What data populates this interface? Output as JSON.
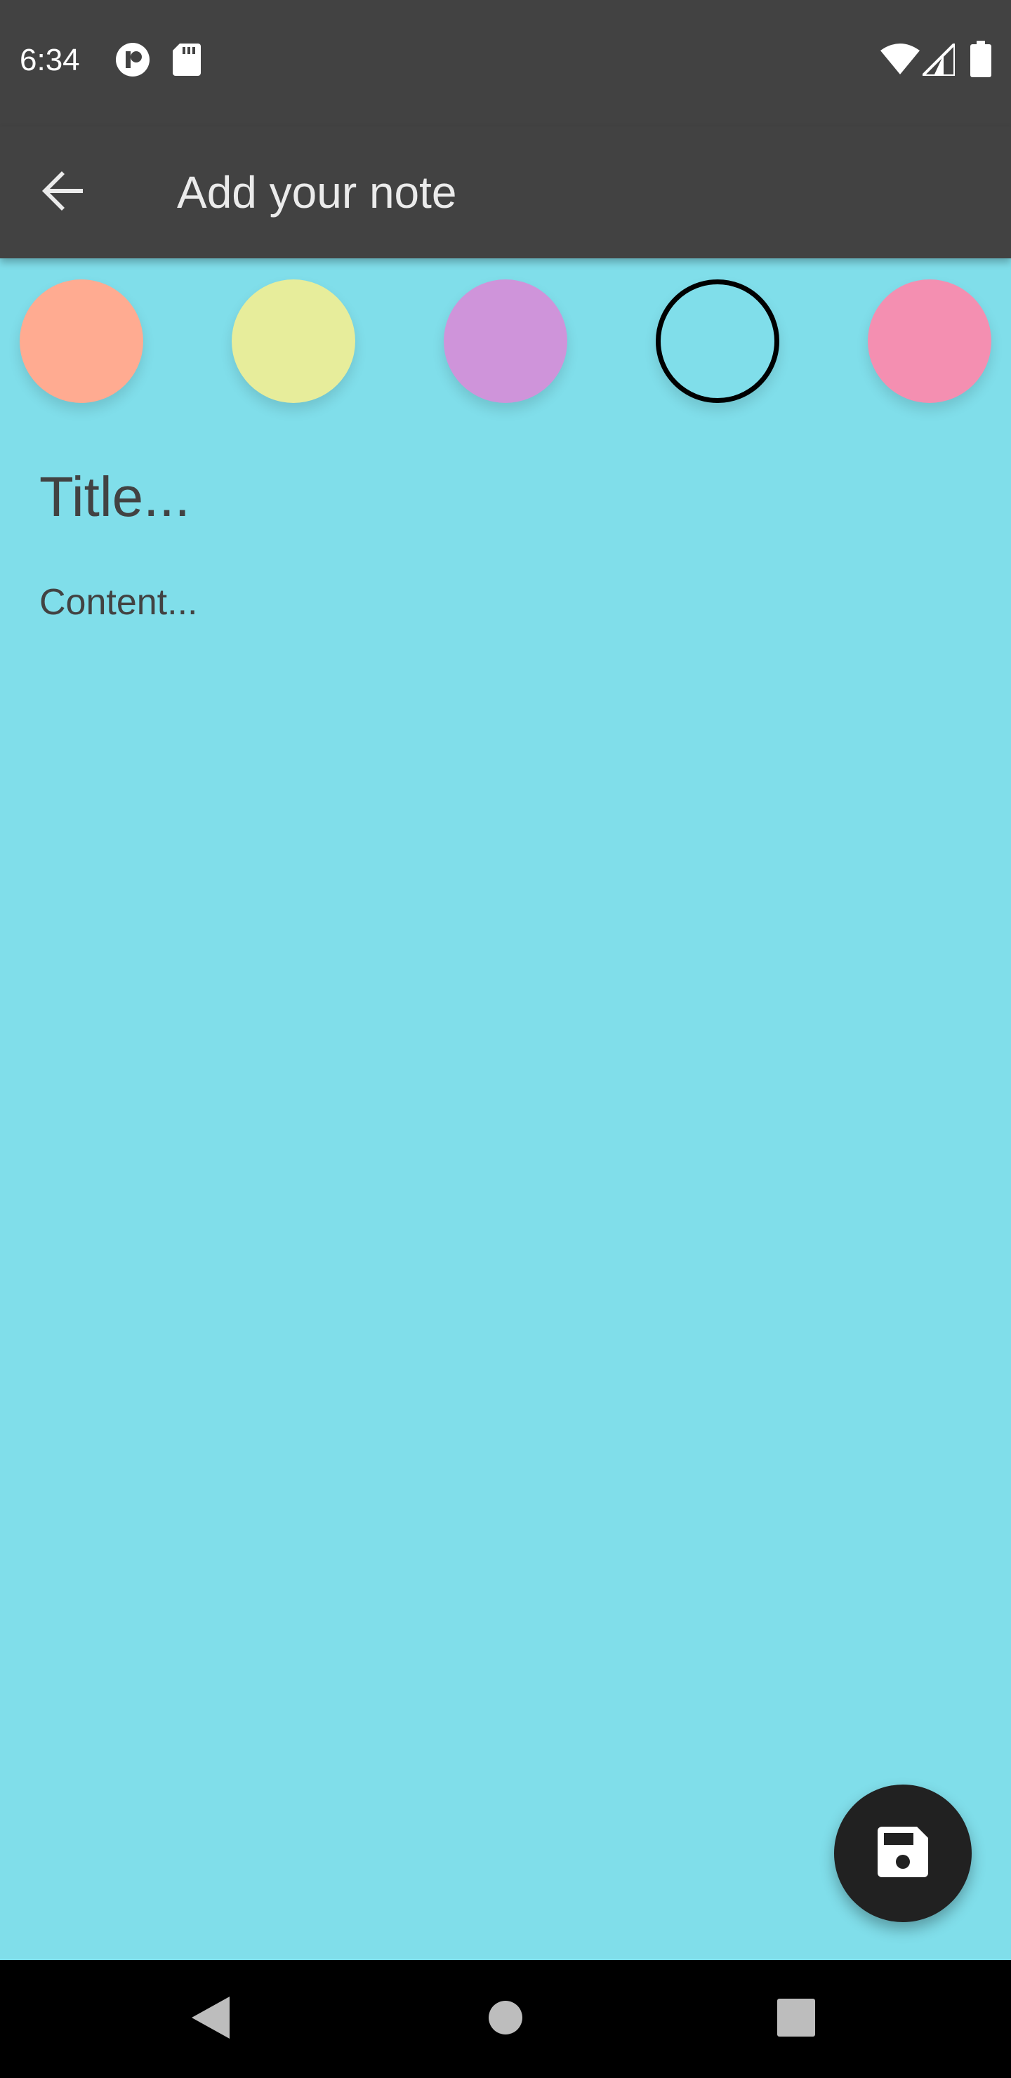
{
  "status_bar": {
    "time": "6:34",
    "icons": [
      "notification-app-icon",
      "sd-card-icon",
      "wifi-icon",
      "cellular-signal-icon",
      "battery-icon"
    ]
  },
  "app_bar": {
    "back_icon": "arrow-back-icon",
    "title": "Add your note"
  },
  "color_picker": {
    "colors": [
      "#ffab91",
      "#e7ed9b",
      "#cf94da",
      "#80deea",
      "#f48fb1"
    ],
    "selected_index": 3
  },
  "editor": {
    "title_placeholder": "Title...",
    "content_placeholder": "Content..."
  },
  "fab": {
    "icon": "save-icon"
  },
  "nav_bar": {
    "icons": [
      "back-triangle-icon",
      "home-circle-icon",
      "recents-square-icon"
    ]
  },
  "theme": {
    "bar_color": "#424242",
    "background": "#80deea",
    "fab_color": "#212121"
  }
}
